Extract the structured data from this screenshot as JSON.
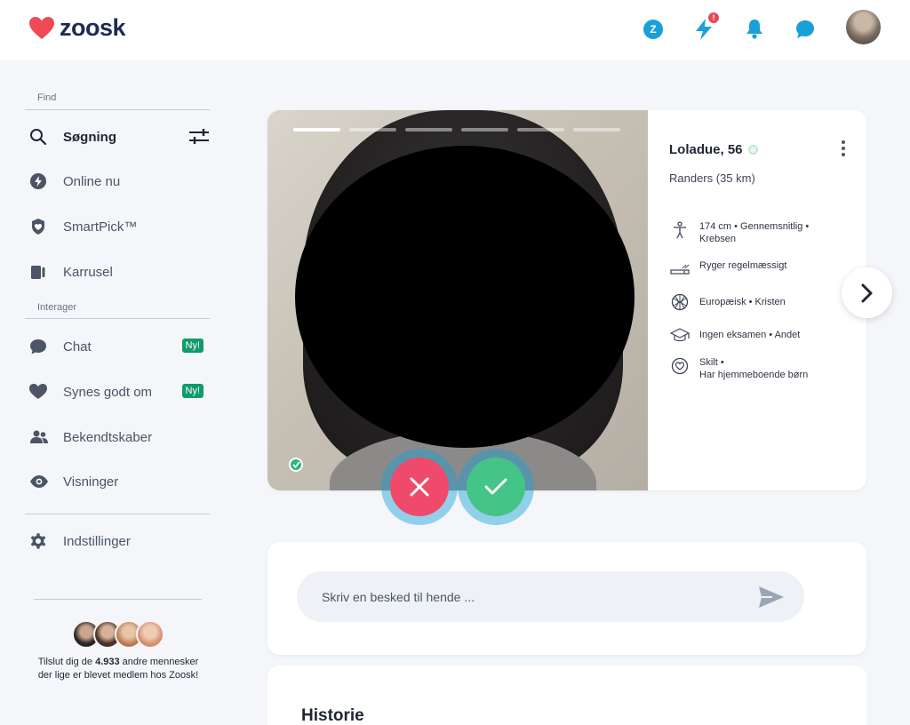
{
  "brand": {
    "name": "zoosk"
  },
  "header": {
    "icons": [
      "zoosk-coin-icon",
      "boost-icon",
      "bell-icon",
      "chat-icon",
      "avatar"
    ],
    "coin_label": "Z",
    "boost_badge": "!"
  },
  "sidebar": {
    "find_label": "Find",
    "search": {
      "label": "Søgning"
    },
    "items_find": [
      {
        "label": "Online nu",
        "icon": "bolt-icon"
      },
      {
        "label": "SmartPick™",
        "icon": "smartpick-icon"
      },
      {
        "label": "Karrusel",
        "icon": "carousel-icon"
      }
    ],
    "interact_label": "Interager",
    "items_interact": [
      {
        "label": "Chat",
        "badge": "Ny!",
        "icon": "chat-bubble-icon"
      },
      {
        "label": "Synes godt om",
        "badge": "Ny!",
        "icon": "heart-icon"
      },
      {
        "label": "Bekendtskaber",
        "icon": "people-icon"
      },
      {
        "label": "Visninger",
        "icon": "eye-icon"
      }
    ],
    "settings": {
      "label": "Indstillinger"
    },
    "join": {
      "prefix": "Tilslut dig de ",
      "count": "4.933",
      "suffix": " andre mennesker der lige er blevet medlem hos Zoosk!"
    }
  },
  "profile": {
    "name": "Loladue, 56",
    "location": "Randers (35 km)",
    "photo_count": 6,
    "photo_current": 1,
    "attributes": [
      {
        "icon": "height-icon",
        "text": "174 cm • Gennemsnitlig • Krebsen"
      },
      {
        "icon": "cigarette-icon",
        "text": "Ryger regelmæssigt"
      },
      {
        "icon": "globe-icon",
        "text": "Europæisk • Kristen"
      },
      {
        "icon": "graduation-cap-icon",
        "text": "Ingen eksamen • Andet"
      },
      {
        "icon": "heart-circle-icon",
        "text": "Skilt •\nHar hjemmeboende børn"
      }
    ]
  },
  "message": {
    "placeholder": "Skriv en besked til hende ..."
  },
  "history": {
    "title": "Historie"
  },
  "colors": {
    "brand_navy": "#1e2a52",
    "heart_red": "#ef4a6b",
    "accent_blue": "#1aa0d8",
    "accept_green": "#45c488",
    "badge_green": "#0f9b6b"
  }
}
